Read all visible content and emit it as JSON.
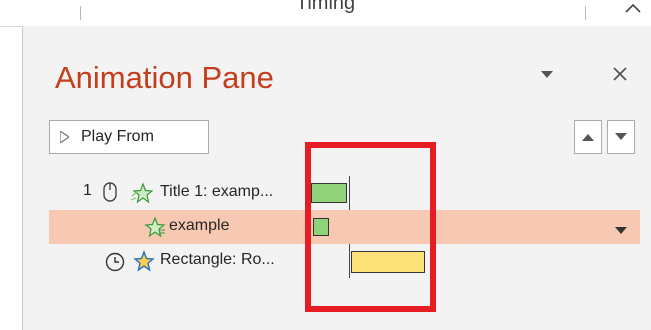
{
  "ribbon": {
    "group_label": "Timing"
  },
  "pane": {
    "title": "Animation Pane",
    "play_label": "Play From",
    "items": [
      {
        "number": "1",
        "label": "Title 1: examp...",
        "trigger": "on-click",
        "effect": "entrance-star",
        "duration_fraction": 0.26,
        "selected": false
      },
      {
        "number": "",
        "label": "example",
        "trigger": "with-previous",
        "effect": "entrance-star",
        "duration_fraction": 0.13,
        "selected": true
      },
      {
        "number": "",
        "label": "Rectangle: Ro...",
        "trigger": "after-previous",
        "effect": "entrance-star",
        "duration_fraction": 0.58,
        "selected": false
      }
    ]
  },
  "colors": {
    "title": "#c43e1c",
    "selection": "#f8c9b2",
    "bar_green": "#8fd27a",
    "bar_yellow": "#fde27a",
    "highlight": "#e81c24"
  }
}
